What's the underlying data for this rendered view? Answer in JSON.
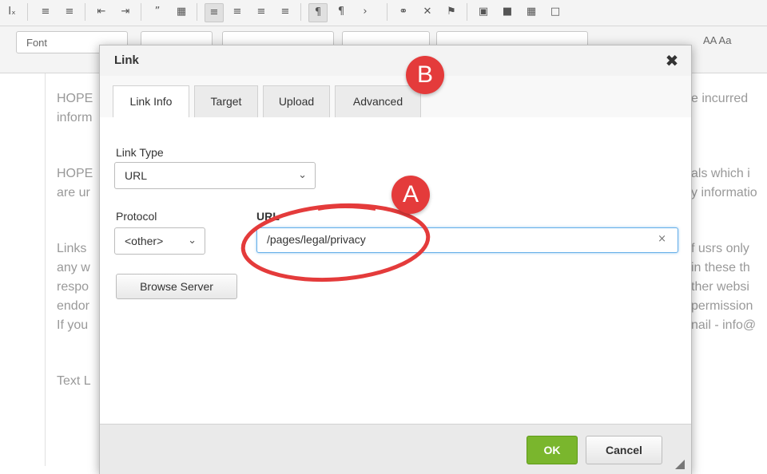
{
  "toolbar": {
    "row1_icons": [
      "clear-format-icon",
      "numbered-list-icon",
      "bullet-list-icon",
      "decrease-indent-icon",
      "increase-indent-icon",
      "blockquote-icon",
      "div-icon",
      "align-left-icon",
      "align-center-icon",
      "align-right-icon",
      "justify-icon",
      "ltr-icon",
      "rtl-icon",
      "language-icon",
      "link-icon",
      "unlink-icon",
      "anchor-icon",
      "image-icon",
      "flash-icon",
      "table-icon",
      "template-icon"
    ],
    "font_label": "Font",
    "right_tools": "AA  Aa"
  },
  "editor": {
    "left_lines": [
      "HOPE",
      "inform",
      "HOPE",
      "are ur",
      "Links",
      "any w",
      "respo",
      "endor",
      "If you",
      "Text L"
    ],
    "right_lines": [
      "e incurred",
      "als which i",
      "y informatio",
      "f usrs only",
      "in these th",
      "ther websi",
      "permission",
      "nail - info@"
    ]
  },
  "dialog": {
    "title": "Link",
    "tabs": [
      "Link Info",
      "Target",
      "Upload",
      "Advanced"
    ],
    "link_type_label": "Link Type",
    "link_type_value": "URL",
    "protocol_label": "Protocol",
    "protocol_value": "<other>",
    "url_label": "URL",
    "url_value": "/pages/legal/privacy",
    "browse_label": "Browse Server",
    "ok_label": "OK",
    "cancel_label": "Cancel"
  },
  "annotations": {
    "a_label": "A",
    "b_label": "B",
    "color": "#e43b3b"
  }
}
